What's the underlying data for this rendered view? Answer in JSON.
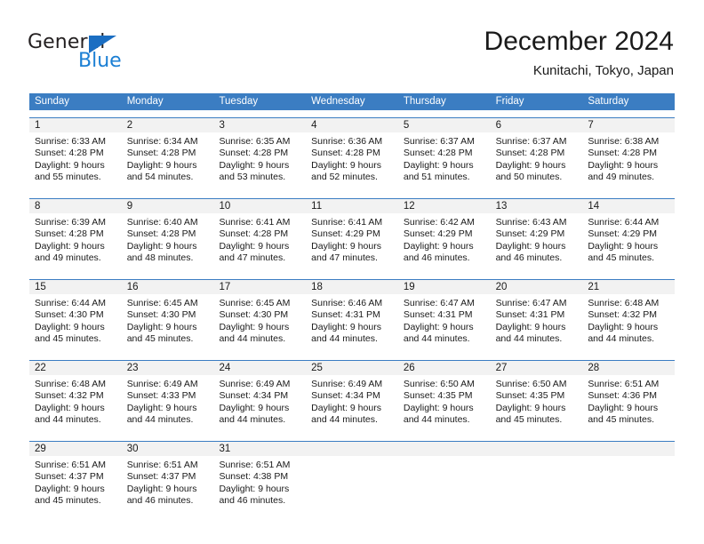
{
  "brand": {
    "word_top": "General",
    "word_bottom": "Blue",
    "accent_color": "#1b6ec2",
    "blue_text_color": "#1b7fd4"
  },
  "header": {
    "title": "December 2024",
    "subtitle": "Kunitachi, Tokyo, Japan"
  },
  "calendar": {
    "header_bg": "#3b7dc2",
    "daynum_bg": "#f2f2f2",
    "weekdays": [
      "Sunday",
      "Monday",
      "Tuesday",
      "Wednesday",
      "Thursday",
      "Friday",
      "Saturday"
    ],
    "weeks": [
      {
        "days": [
          {
            "num": "1",
            "l1": "Sunrise: 6:33 AM",
            "l2": "Sunset: 4:28 PM",
            "l3": "Daylight: 9 hours",
            "l4": "and 55 minutes."
          },
          {
            "num": "2",
            "l1": "Sunrise: 6:34 AM",
            "l2": "Sunset: 4:28 PM",
            "l3": "Daylight: 9 hours",
            "l4": "and 54 minutes."
          },
          {
            "num": "3",
            "l1": "Sunrise: 6:35 AM",
            "l2": "Sunset: 4:28 PM",
            "l3": "Daylight: 9 hours",
            "l4": "and 53 minutes."
          },
          {
            "num": "4",
            "l1": "Sunrise: 6:36 AM",
            "l2": "Sunset: 4:28 PM",
            "l3": "Daylight: 9 hours",
            "l4": "and 52 minutes."
          },
          {
            "num": "5",
            "l1": "Sunrise: 6:37 AM",
            "l2": "Sunset: 4:28 PM",
            "l3": "Daylight: 9 hours",
            "l4": "and 51 minutes."
          },
          {
            "num": "6",
            "l1": "Sunrise: 6:37 AM",
            "l2": "Sunset: 4:28 PM",
            "l3": "Daylight: 9 hours",
            "l4": "and 50 minutes."
          },
          {
            "num": "7",
            "l1": "Sunrise: 6:38 AM",
            "l2": "Sunset: 4:28 PM",
            "l3": "Daylight: 9 hours",
            "l4": "and 49 minutes."
          }
        ]
      },
      {
        "days": [
          {
            "num": "8",
            "l1": "Sunrise: 6:39 AM",
            "l2": "Sunset: 4:28 PM",
            "l3": "Daylight: 9 hours",
            "l4": "and 49 minutes."
          },
          {
            "num": "9",
            "l1": "Sunrise: 6:40 AM",
            "l2": "Sunset: 4:28 PM",
            "l3": "Daylight: 9 hours",
            "l4": "and 48 minutes."
          },
          {
            "num": "10",
            "l1": "Sunrise: 6:41 AM",
            "l2": "Sunset: 4:28 PM",
            "l3": "Daylight: 9 hours",
            "l4": "and 47 minutes."
          },
          {
            "num": "11",
            "l1": "Sunrise: 6:41 AM",
            "l2": "Sunset: 4:29 PM",
            "l3": "Daylight: 9 hours",
            "l4": "and 47 minutes."
          },
          {
            "num": "12",
            "l1": "Sunrise: 6:42 AM",
            "l2": "Sunset: 4:29 PM",
            "l3": "Daylight: 9 hours",
            "l4": "and 46 minutes."
          },
          {
            "num": "13",
            "l1": "Sunrise: 6:43 AM",
            "l2": "Sunset: 4:29 PM",
            "l3": "Daylight: 9 hours",
            "l4": "and 46 minutes."
          },
          {
            "num": "14",
            "l1": "Sunrise: 6:44 AM",
            "l2": "Sunset: 4:29 PM",
            "l3": "Daylight: 9 hours",
            "l4": "and 45 minutes."
          }
        ]
      },
      {
        "days": [
          {
            "num": "15",
            "l1": "Sunrise: 6:44 AM",
            "l2": "Sunset: 4:30 PM",
            "l3": "Daylight: 9 hours",
            "l4": "and 45 minutes."
          },
          {
            "num": "16",
            "l1": "Sunrise: 6:45 AM",
            "l2": "Sunset: 4:30 PM",
            "l3": "Daylight: 9 hours",
            "l4": "and 45 minutes."
          },
          {
            "num": "17",
            "l1": "Sunrise: 6:45 AM",
            "l2": "Sunset: 4:30 PM",
            "l3": "Daylight: 9 hours",
            "l4": "and 44 minutes."
          },
          {
            "num": "18",
            "l1": "Sunrise: 6:46 AM",
            "l2": "Sunset: 4:31 PM",
            "l3": "Daylight: 9 hours",
            "l4": "and 44 minutes."
          },
          {
            "num": "19",
            "l1": "Sunrise: 6:47 AM",
            "l2": "Sunset: 4:31 PM",
            "l3": "Daylight: 9 hours",
            "l4": "and 44 minutes."
          },
          {
            "num": "20",
            "l1": "Sunrise: 6:47 AM",
            "l2": "Sunset: 4:31 PM",
            "l3": "Daylight: 9 hours",
            "l4": "and 44 minutes."
          },
          {
            "num": "21",
            "l1": "Sunrise: 6:48 AM",
            "l2": "Sunset: 4:32 PM",
            "l3": "Daylight: 9 hours",
            "l4": "and 44 minutes."
          }
        ]
      },
      {
        "days": [
          {
            "num": "22",
            "l1": "Sunrise: 6:48 AM",
            "l2": "Sunset: 4:32 PM",
            "l3": "Daylight: 9 hours",
            "l4": "and 44 minutes."
          },
          {
            "num": "23",
            "l1": "Sunrise: 6:49 AM",
            "l2": "Sunset: 4:33 PM",
            "l3": "Daylight: 9 hours",
            "l4": "and 44 minutes."
          },
          {
            "num": "24",
            "l1": "Sunrise: 6:49 AM",
            "l2": "Sunset: 4:34 PM",
            "l3": "Daylight: 9 hours",
            "l4": "and 44 minutes."
          },
          {
            "num": "25",
            "l1": "Sunrise: 6:49 AM",
            "l2": "Sunset: 4:34 PM",
            "l3": "Daylight: 9 hours",
            "l4": "and 44 minutes."
          },
          {
            "num": "26",
            "l1": "Sunrise: 6:50 AM",
            "l2": "Sunset: 4:35 PM",
            "l3": "Daylight: 9 hours",
            "l4": "and 44 minutes."
          },
          {
            "num": "27",
            "l1": "Sunrise: 6:50 AM",
            "l2": "Sunset: 4:35 PM",
            "l3": "Daylight: 9 hours",
            "l4": "and 45 minutes."
          },
          {
            "num": "28",
            "l1": "Sunrise: 6:51 AM",
            "l2": "Sunset: 4:36 PM",
            "l3": "Daylight: 9 hours",
            "l4": "and 45 minutes."
          }
        ]
      },
      {
        "days": [
          {
            "num": "29",
            "l1": "Sunrise: 6:51 AM",
            "l2": "Sunset: 4:37 PM",
            "l3": "Daylight: 9 hours",
            "l4": "and 45 minutes."
          },
          {
            "num": "30",
            "l1": "Sunrise: 6:51 AM",
            "l2": "Sunset: 4:37 PM",
            "l3": "Daylight: 9 hours",
            "l4": "and 46 minutes."
          },
          {
            "num": "31",
            "l1": "Sunrise: 6:51 AM",
            "l2": "Sunset: 4:38 PM",
            "l3": "Daylight: 9 hours",
            "l4": "and 46 minutes."
          },
          {
            "num": "",
            "l1": "",
            "l2": "",
            "l3": "",
            "l4": ""
          },
          {
            "num": "",
            "l1": "",
            "l2": "",
            "l3": "",
            "l4": ""
          },
          {
            "num": "",
            "l1": "",
            "l2": "",
            "l3": "",
            "l4": ""
          },
          {
            "num": "",
            "l1": "",
            "l2": "",
            "l3": "",
            "l4": ""
          }
        ]
      }
    ]
  }
}
